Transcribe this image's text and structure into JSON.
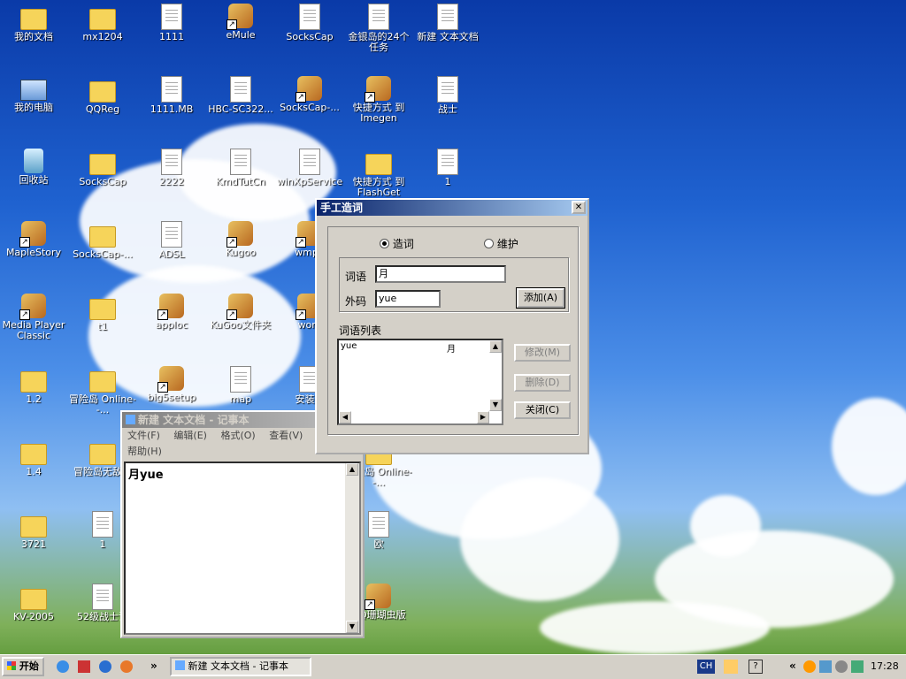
{
  "desktop_icons": [
    {
      "label": "我的文档",
      "type": "folder"
    },
    {
      "label": "mx1204",
      "type": "folder"
    },
    {
      "label": "1111",
      "type": "doc"
    },
    {
      "label": "eMule",
      "type": "app"
    },
    {
      "label": "SocksCap",
      "type": "doc"
    },
    {
      "label": "金银岛的24个任务",
      "type": "doc"
    },
    {
      "label": "新建 文本文档",
      "type": "doc"
    },
    {
      "label": "我的电脑",
      "type": "comp"
    },
    {
      "label": "QQReg",
      "type": "folder"
    },
    {
      "label": "1111.MB",
      "type": "doc"
    },
    {
      "label": "HBC-SC322...",
      "type": "doc"
    },
    {
      "label": "SocksCap-...",
      "type": "app"
    },
    {
      "label": "快捷方式 到 Imegen",
      "type": "app"
    },
    {
      "label": "战士",
      "type": "doc"
    },
    {
      "label": "回收站",
      "type": "bin"
    },
    {
      "label": "SocksCap",
      "type": "folder"
    },
    {
      "label": "2222",
      "type": "doc"
    },
    {
      "label": "KmdTutCn",
      "type": "doc"
    },
    {
      "label": "winXpService",
      "type": "doc"
    },
    {
      "label": "快捷方式 到 FlashGet",
      "type": "folder"
    },
    {
      "label": "1",
      "type": "doc"
    },
    {
      "label": "MapleStory",
      "type": "app"
    },
    {
      "label": "SocksCap-...",
      "type": "folder"
    },
    {
      "label": "ADSL",
      "type": "doc"
    },
    {
      "label": "Kugoo",
      "type": "app"
    },
    {
      "label": "wmp6",
      "type": "app"
    },
    {
      "label": "Media Player Classic",
      "type": "app"
    },
    {
      "label": "t1",
      "type": "folder"
    },
    {
      "label": "apploc",
      "type": "app"
    },
    {
      "label": "KuGoo文件夹",
      "type": "app"
    },
    {
      "label": "word",
      "type": "app"
    },
    {
      "label": "1.2",
      "type": "folder"
    },
    {
      "label": "冒险岛 Online--...",
      "type": "folder"
    },
    {
      "label": "big5setup",
      "type": "app"
    },
    {
      "label": "map",
      "type": "doc"
    },
    {
      "label": "安装说",
      "type": "doc"
    },
    {
      "label": "1.4",
      "type": "folder"
    },
    {
      "label": "冒险岛无敌挂",
      "type": "folder"
    },
    {
      "label": "冒险岛 Online--...",
      "type": "folder"
    },
    {
      "label": "3721",
      "type": "folder"
    },
    {
      "label": "1",
      "type": "doc"
    },
    {
      "label": "欧",
      "type": "doc"
    },
    {
      "label": "KV-2005",
      "type": "folder"
    },
    {
      "label": "52级战士说",
      "type": "doc"
    },
    {
      "label": "QQ珊瑚虫版",
      "type": "app"
    }
  ],
  "dialog": {
    "title": "手工造词",
    "radio_zaoci": "造词",
    "radio_weihu": "维护",
    "label_ciyu": "词语",
    "value_ciyu": "月",
    "label_waima": "外码",
    "value_waima": "yue",
    "add_button": "添加(A)",
    "list_label": "词语列表",
    "list_row_code": "yue",
    "list_row_word": "月",
    "modify_button": "修改(M)",
    "delete_button": "删除(D)",
    "close_button": "关闭(C)",
    "close_x": "✕"
  },
  "notepad": {
    "title": "新建 文本文档 - 记事本",
    "menu_file": "文件(F)",
    "menu_edit": "编辑(E)",
    "menu_format": "格式(O)",
    "menu_view": "查看(V)",
    "menu_help": "帮助(H)",
    "content": "月yue"
  },
  "taskbar": {
    "start_label": "开始",
    "task_label": "新建 文本文档 - 记事本",
    "quicklaunch_more": "»",
    "ime_label": "CH",
    "tray_arrow": "«",
    "clock": "17:28"
  }
}
